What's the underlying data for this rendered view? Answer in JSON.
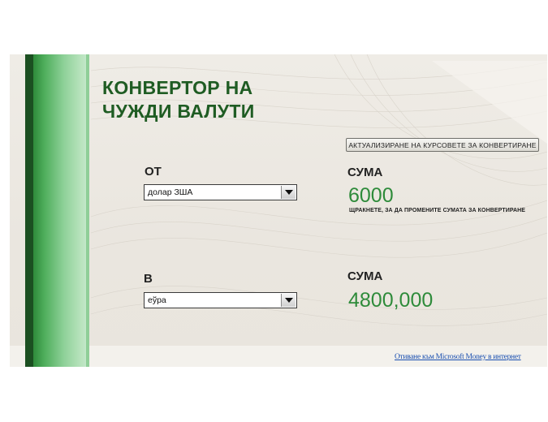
{
  "title_line1": "КОНВЕРТОР НА",
  "title_line2": "ЧУЖДИ ВАЛУТИ",
  "update_button": "АКТУАЛИЗИРАНЕ НА КУРСОВЕТЕ ЗА КОНВЕРТИРАНЕ",
  "from": {
    "label": "ОТ",
    "currency": "долар ЗША"
  },
  "to": {
    "label": "В",
    "currency": "еўра"
  },
  "amount_from": {
    "label": "СУМА",
    "value": "6000",
    "hint": "ЩРАКНЕТЕ, ЗА ДА ПРОМЕНИТЕ СУМАТА ЗА КОНВЕРТИРАНЕ"
  },
  "amount_to": {
    "label": "СУМА",
    "value": "4800,000"
  },
  "footer_link": "Отиване към Microsoft Money в интернет",
  "colors": {
    "accent": "#1f5c23",
    "amount": "#2e8b3a",
    "stripe_dark": "#1b4f21"
  }
}
